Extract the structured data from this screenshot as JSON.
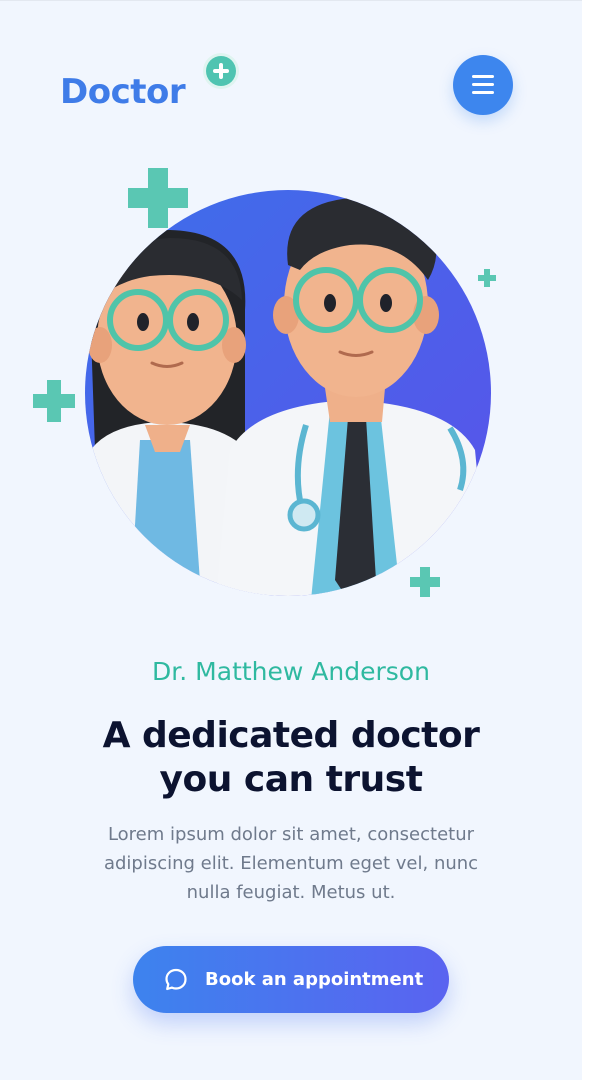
{
  "header": {
    "logo_text": "Doctor",
    "logo_badge_icon": "plus-icon",
    "menu_icon": "hamburger-icon"
  },
  "hero": {
    "illustration": "two-doctors-illustration",
    "decorations": [
      "plus-icon",
      "plus-icon",
      "plus-icon",
      "plus-icon"
    ]
  },
  "content": {
    "doctor_name": "Dr. Matthew Anderson",
    "headline_line1": "A dedicated doctor",
    "headline_line2": "you can trust",
    "description": "Lorem ipsum dolor sit amet, consectetur adipiscing elit. Elementum eget vel, nunc nulla feugiat. Metus ut."
  },
  "cta": {
    "label": "Book an appointment",
    "icon": "chat-bubble-icon"
  },
  "colors": {
    "background": "#f1f6fe",
    "brand_blue": "#3f7ce8",
    "accent_teal": "#2fb9a0",
    "headline": "#0c1330",
    "body_text": "#6f7a8c"
  }
}
